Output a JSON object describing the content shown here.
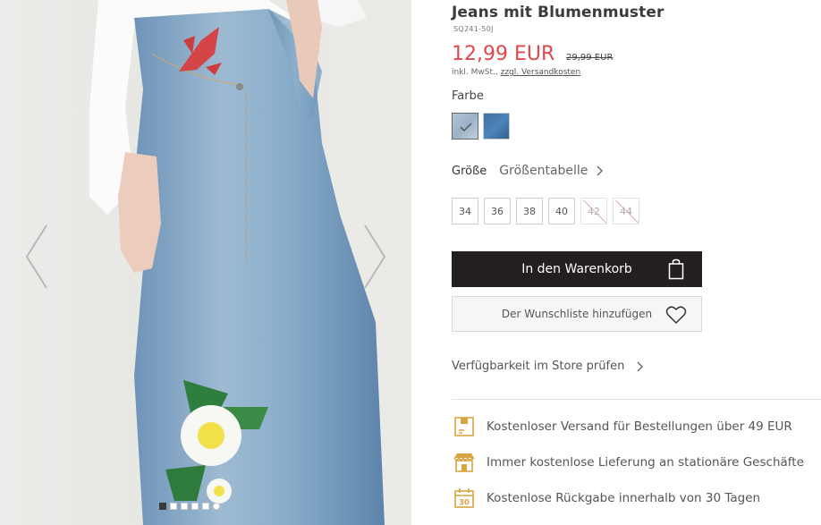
{
  "product": {
    "title": "Jeans mit Blumenmuster",
    "sku": "SQ241-50J",
    "price": "12,99 EUR",
    "old_price": "29,99 EUR",
    "vat_prefix": "inkl. MwSt.,",
    "shipping_link": "zzgl. Versandkosten"
  },
  "color": {
    "label": "Farbe",
    "swatches": [
      "light-blue-denim",
      "dark-blue-denim"
    ],
    "selected": "light-blue-denim"
  },
  "size": {
    "label": "Größe",
    "table_link": "Größentabelle",
    "options": [
      {
        "label": "34",
        "available": true
      },
      {
        "label": "36",
        "available": true
      },
      {
        "label": "38",
        "available": true
      },
      {
        "label": "40",
        "available": true
      },
      {
        "label": "42",
        "available": false
      },
      {
        "label": "44",
        "available": false
      }
    ]
  },
  "actions": {
    "add_to_cart": "In den Warenkorb",
    "add_to_wishlist": "Der Wunschliste hinzufügen",
    "store_availability": "Verfügbarkeit im Store prüfen"
  },
  "benefits": [
    {
      "icon": "box-icon",
      "text": "Kostenloser Versand für Bestellungen über 49 EUR"
    },
    {
      "icon": "store-icon",
      "text": "Immer kostenlose Lieferung an stationäre Geschäfte"
    },
    {
      "icon": "calendar-30-icon",
      "text": "Kostenlose Rückgabe innerhalb von 30 Tagen"
    },
    {
      "calendar_number": "30"
    }
  ],
  "gallery": {
    "image_count": 6,
    "active_index": 0
  },
  "colors": {
    "price_red": "#e0474c",
    "cart_button": "#231f20",
    "benefit_icon_gold": "#d9a441"
  }
}
